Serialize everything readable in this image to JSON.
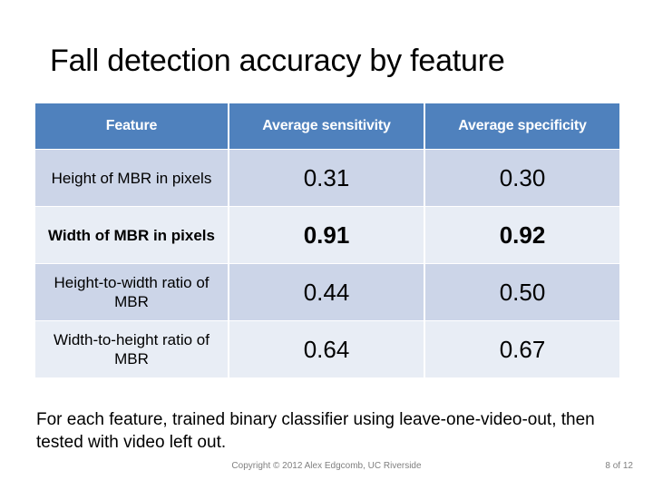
{
  "slide": {
    "title": "Fall detection accuracy by feature",
    "body_text": "For each feature, trained binary classifier using leave-one-video-out, then tested with video left out.",
    "footer": {
      "copyright": "Copyright © 2012 Alex Edgcomb, UC Riverside",
      "page_number": "8 of 12"
    },
    "colors": {
      "header_background": "#4f81bd",
      "header_text": "#ffffff",
      "row_dark": "#ccd5e8",
      "row_light": "#e8edf5",
      "footer_text": "#808080"
    }
  },
  "table": {
    "headers": [
      "Feature",
      "Average sensitivity",
      "Average specificity"
    ],
    "rows": [
      {
        "feature": "Height of MBR in pixels",
        "average_sensitivity": "0.31",
        "average_specificity": "0.30",
        "emphasis": false
      },
      {
        "feature": "Width of MBR in pixels",
        "average_sensitivity": "0.91",
        "average_specificity": "0.92",
        "emphasis": true
      },
      {
        "feature": "Height-to-width ratio of MBR",
        "average_sensitivity": "0.44",
        "average_specificity": "0.50",
        "emphasis": false
      },
      {
        "feature": "Width-to-height ratio of MBR",
        "average_sensitivity": "0.64",
        "average_specificity": "0.67",
        "emphasis": false
      }
    ]
  }
}
